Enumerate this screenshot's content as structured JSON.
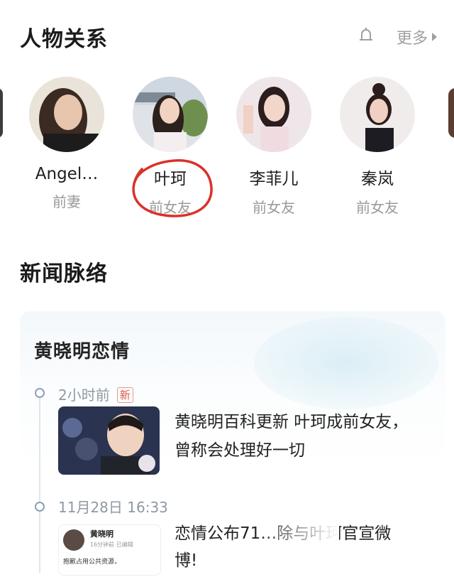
{
  "relations": {
    "title": "人物关系",
    "more_label": "更多",
    "people": [
      {
        "name": "Angel…",
        "relation": "前妻"
      },
      {
        "name": "叶珂",
        "relation": "前女友"
      },
      {
        "name": "李菲儿",
        "relation": "前女友"
      },
      {
        "name": "秦岚",
        "relation": "前女友"
      }
    ]
  },
  "news": {
    "title": "新闻脉络",
    "card_title": "黄晓明恋情",
    "items": [
      {
        "time": "2小时前",
        "badge": "新",
        "headline": "黄晓明百科更新 叶珂成前女友，曾称会处理好一切"
      },
      {
        "time": "11月28日 16:33",
        "headline": "恋情公布71…除与叶珂官宣微博!",
        "thumb_name": "黄晓明",
        "thumb_meta": "16分钟前  已编辑",
        "thumb_text": "抱歉占用公共资源，"
      }
    ]
  },
  "colors": {
    "accent_red": "#e25546",
    "timeline": "#8aa0b8",
    "annotation": "#d9322a"
  }
}
